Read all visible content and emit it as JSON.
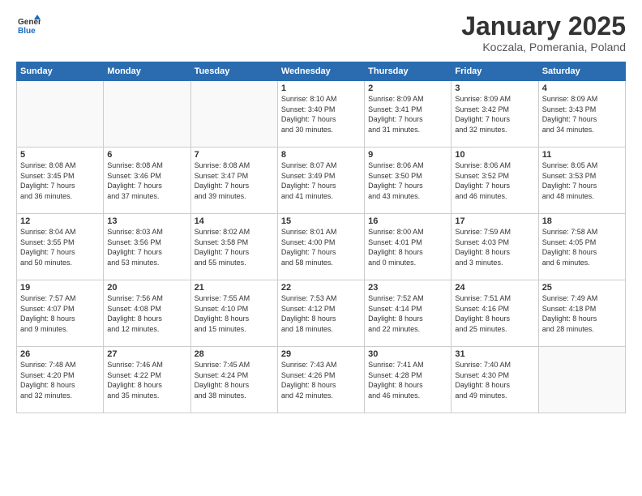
{
  "header": {
    "logo_general": "General",
    "logo_blue": "Blue",
    "month_title": "January 2025",
    "location": "Koczala, Pomerania, Poland"
  },
  "weekdays": [
    "Sunday",
    "Monday",
    "Tuesday",
    "Wednesday",
    "Thursday",
    "Friday",
    "Saturday"
  ],
  "weeks": [
    [
      {
        "day": "",
        "info": ""
      },
      {
        "day": "",
        "info": ""
      },
      {
        "day": "",
        "info": ""
      },
      {
        "day": "1",
        "info": "Sunrise: 8:10 AM\nSunset: 3:40 PM\nDaylight: 7 hours\nand 30 minutes."
      },
      {
        "day": "2",
        "info": "Sunrise: 8:09 AM\nSunset: 3:41 PM\nDaylight: 7 hours\nand 31 minutes."
      },
      {
        "day": "3",
        "info": "Sunrise: 8:09 AM\nSunset: 3:42 PM\nDaylight: 7 hours\nand 32 minutes."
      },
      {
        "day": "4",
        "info": "Sunrise: 8:09 AM\nSunset: 3:43 PM\nDaylight: 7 hours\nand 34 minutes."
      }
    ],
    [
      {
        "day": "5",
        "info": "Sunrise: 8:08 AM\nSunset: 3:45 PM\nDaylight: 7 hours\nand 36 minutes."
      },
      {
        "day": "6",
        "info": "Sunrise: 8:08 AM\nSunset: 3:46 PM\nDaylight: 7 hours\nand 37 minutes."
      },
      {
        "day": "7",
        "info": "Sunrise: 8:08 AM\nSunset: 3:47 PM\nDaylight: 7 hours\nand 39 minutes."
      },
      {
        "day": "8",
        "info": "Sunrise: 8:07 AM\nSunset: 3:49 PM\nDaylight: 7 hours\nand 41 minutes."
      },
      {
        "day": "9",
        "info": "Sunrise: 8:06 AM\nSunset: 3:50 PM\nDaylight: 7 hours\nand 43 minutes."
      },
      {
        "day": "10",
        "info": "Sunrise: 8:06 AM\nSunset: 3:52 PM\nDaylight: 7 hours\nand 46 minutes."
      },
      {
        "day": "11",
        "info": "Sunrise: 8:05 AM\nSunset: 3:53 PM\nDaylight: 7 hours\nand 48 minutes."
      }
    ],
    [
      {
        "day": "12",
        "info": "Sunrise: 8:04 AM\nSunset: 3:55 PM\nDaylight: 7 hours\nand 50 minutes."
      },
      {
        "day": "13",
        "info": "Sunrise: 8:03 AM\nSunset: 3:56 PM\nDaylight: 7 hours\nand 53 minutes."
      },
      {
        "day": "14",
        "info": "Sunrise: 8:02 AM\nSunset: 3:58 PM\nDaylight: 7 hours\nand 55 minutes."
      },
      {
        "day": "15",
        "info": "Sunrise: 8:01 AM\nSunset: 4:00 PM\nDaylight: 7 hours\nand 58 minutes."
      },
      {
        "day": "16",
        "info": "Sunrise: 8:00 AM\nSunset: 4:01 PM\nDaylight: 8 hours\nand 0 minutes."
      },
      {
        "day": "17",
        "info": "Sunrise: 7:59 AM\nSunset: 4:03 PM\nDaylight: 8 hours\nand 3 minutes."
      },
      {
        "day": "18",
        "info": "Sunrise: 7:58 AM\nSunset: 4:05 PM\nDaylight: 8 hours\nand 6 minutes."
      }
    ],
    [
      {
        "day": "19",
        "info": "Sunrise: 7:57 AM\nSunset: 4:07 PM\nDaylight: 8 hours\nand 9 minutes."
      },
      {
        "day": "20",
        "info": "Sunrise: 7:56 AM\nSunset: 4:08 PM\nDaylight: 8 hours\nand 12 minutes."
      },
      {
        "day": "21",
        "info": "Sunrise: 7:55 AM\nSunset: 4:10 PM\nDaylight: 8 hours\nand 15 minutes."
      },
      {
        "day": "22",
        "info": "Sunrise: 7:53 AM\nSunset: 4:12 PM\nDaylight: 8 hours\nand 18 minutes."
      },
      {
        "day": "23",
        "info": "Sunrise: 7:52 AM\nSunset: 4:14 PM\nDaylight: 8 hours\nand 22 minutes."
      },
      {
        "day": "24",
        "info": "Sunrise: 7:51 AM\nSunset: 4:16 PM\nDaylight: 8 hours\nand 25 minutes."
      },
      {
        "day": "25",
        "info": "Sunrise: 7:49 AM\nSunset: 4:18 PM\nDaylight: 8 hours\nand 28 minutes."
      }
    ],
    [
      {
        "day": "26",
        "info": "Sunrise: 7:48 AM\nSunset: 4:20 PM\nDaylight: 8 hours\nand 32 minutes."
      },
      {
        "day": "27",
        "info": "Sunrise: 7:46 AM\nSunset: 4:22 PM\nDaylight: 8 hours\nand 35 minutes."
      },
      {
        "day": "28",
        "info": "Sunrise: 7:45 AM\nSunset: 4:24 PM\nDaylight: 8 hours\nand 38 minutes."
      },
      {
        "day": "29",
        "info": "Sunrise: 7:43 AM\nSunset: 4:26 PM\nDaylight: 8 hours\nand 42 minutes."
      },
      {
        "day": "30",
        "info": "Sunrise: 7:41 AM\nSunset: 4:28 PM\nDaylight: 8 hours\nand 46 minutes."
      },
      {
        "day": "31",
        "info": "Sunrise: 7:40 AM\nSunset: 4:30 PM\nDaylight: 8 hours\nand 49 minutes."
      },
      {
        "day": "",
        "info": ""
      }
    ]
  ]
}
